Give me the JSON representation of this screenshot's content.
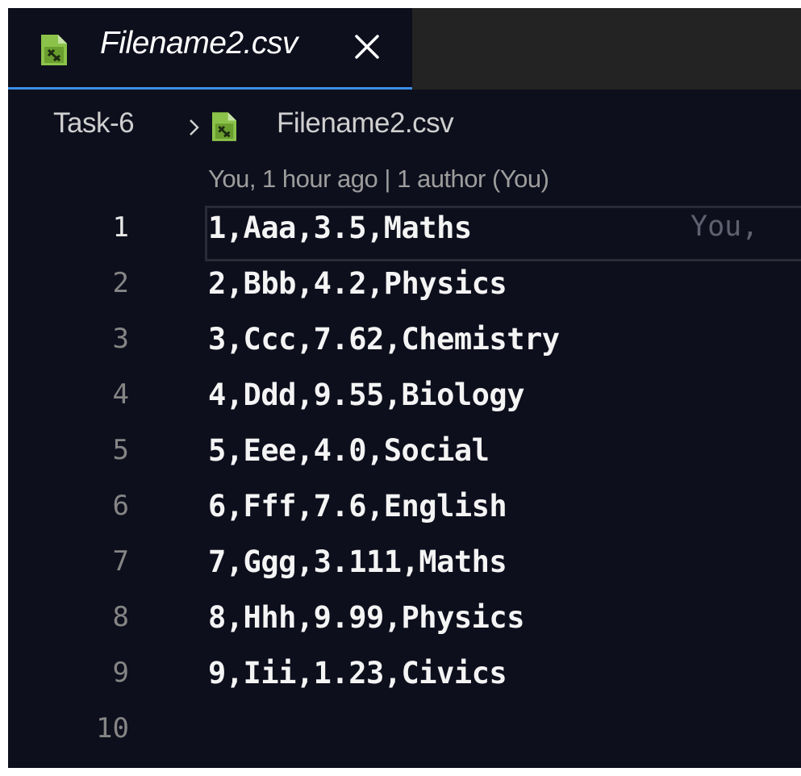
{
  "tab": {
    "title": "Filename2.csv",
    "close_icon": "close-icon",
    "file_icon": "csv-file-icon"
  },
  "breadcrumb": {
    "folder": "Task-6",
    "separator_icon": "chevron-right-icon",
    "file_icon": "csv-file-icon",
    "file": "Filename2.csv"
  },
  "codelens": {
    "author_time": "You, 1 hour ago",
    "separator": "|",
    "authors": "1 author (You)"
  },
  "editor": {
    "lines": [
      {
        "number": "1",
        "text": "1,Aaa,3.5,Maths"
      },
      {
        "number": "2",
        "text": "2,Bbb,4.2,Physics"
      },
      {
        "number": "3",
        "text": "3,Ccc,7.62,Chemistry"
      },
      {
        "number": "4",
        "text": "4,Ddd,9.55,Biology"
      },
      {
        "number": "5",
        "text": "5,Eee,4.0,Social"
      },
      {
        "number": "6",
        "text": "6,Fff,7.6,English"
      },
      {
        "number": "7",
        "text": "7,Ggg,3.111,Maths"
      },
      {
        "number": "8",
        "text": "8,Hhh,9.99,Physics"
      },
      {
        "number": "9",
        "text": "9,Iii,1.23,Civics"
      },
      {
        "number": "10",
        "text": ""
      }
    ],
    "current_line_blame": "You,"
  },
  "colors": {
    "background": "#0e0f1d",
    "tab_active_border": "#3b8fe8",
    "tabbar_background": "#232323",
    "icon_green": "#8bc34a"
  }
}
